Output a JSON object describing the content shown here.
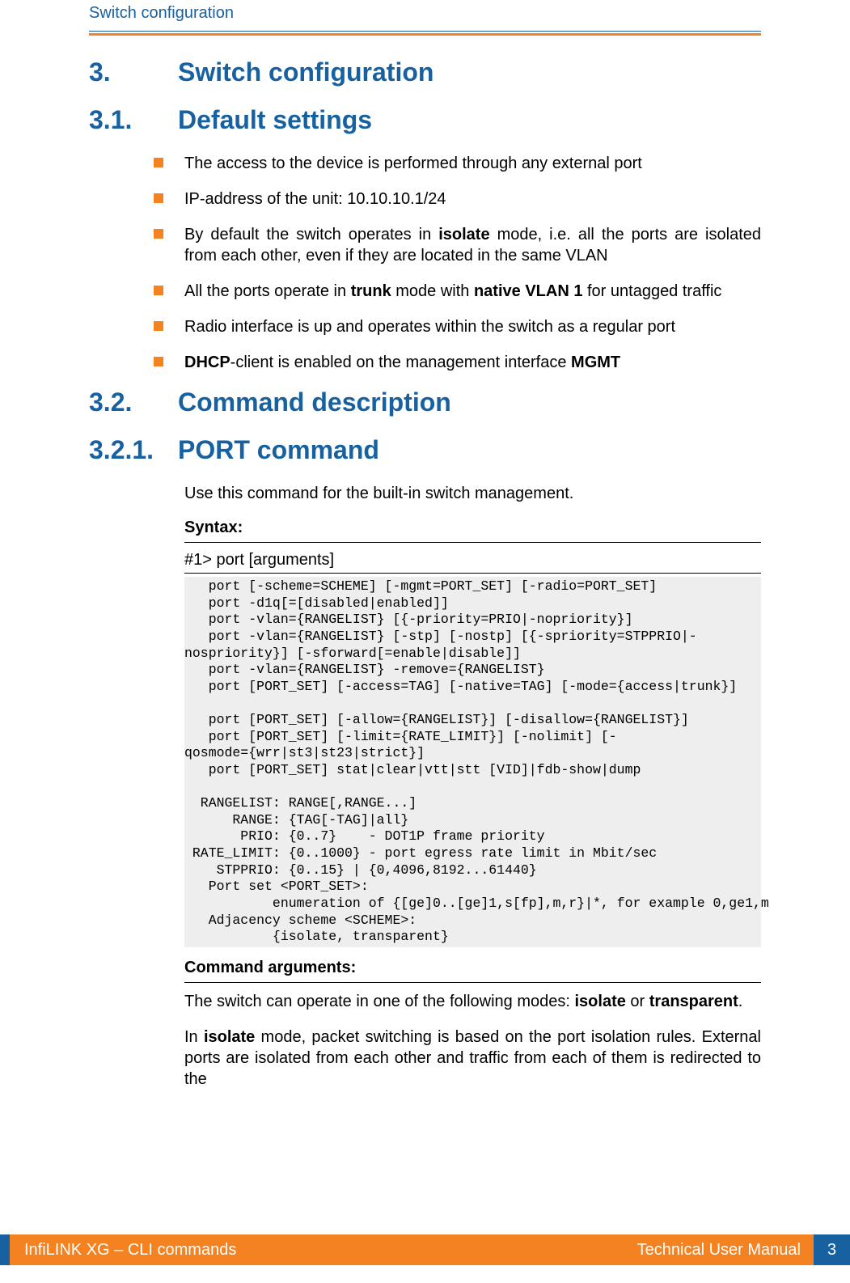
{
  "header": {
    "title": "Switch configuration"
  },
  "section3": {
    "num": "3.",
    "title": "Switch configuration"
  },
  "section31": {
    "num": "3.1.",
    "title": "Default settings",
    "bullets": {
      "b1": "The access to the device is performed through any external port",
      "b2": "IP-address of the unit: 10.10.10.1/24",
      "b3_pre": "By default the switch operates in ",
      "b3_bold": "isolate",
      "b3_post": " mode, i.e. all the ports are isolated from each other, even if they are located in the same VLAN",
      "b4_pre": "All the ports operate in ",
      "b4_b1": "trunk",
      "b4_mid": " mode with ",
      "b4_b2": "native VLAN 1",
      "b4_post": " for untagged traffic",
      "b5": "Radio interface is up and operates within the switch as a regular port",
      "b6_b1": "DHCP",
      "b6_mid": "-client is enabled on the management interface ",
      "b6_b2": "MGMT"
    }
  },
  "section32": {
    "num": "3.2.",
    "title": "Command description"
  },
  "section321": {
    "num": "3.2.1.",
    "title": "PORT command",
    "intro": "Use this command for the built-in switch management.",
    "syntax_label": "Syntax:",
    "prompt": "#1> port [arguments]",
    "code": "   port [-scheme=SCHEME] [-mgmt=PORT_SET] [-radio=PORT_SET]\n   port -d1q[=[disabled|enabled]]\n   port -vlan={RANGELIST} [{-priority=PRIO|-nopriority}]\n   port -vlan={RANGELIST} [-stp] [-nostp] [{-spriority=STPPRIO|-\nnospriority}] [-sforward[=enable|disable]]\n   port -vlan={RANGELIST} -remove={RANGELIST}\n   port [PORT_SET] [-access=TAG] [-native=TAG] [-mode={access|trunk}]\n\n   port [PORT_SET] [-allow={RANGELIST}] [-disallow={RANGELIST}]\n   port [PORT_SET] [-limit={RATE_LIMIT}] [-nolimit] [-\nqosmode={wrr|st3|st23|strict}]\n   port [PORT_SET] stat|clear|vtt|stt [VID]|fdb-show|dump\n\n  RANGELIST: RANGE[,RANGE...]\n      RANGE: {TAG[-TAG]|all}\n       PRIO: {0..7}    - DOT1P frame priority\n RATE_LIMIT: {0..1000} - port egress rate limit in Mbit/sec\n    STPPRIO: {0..15} | {0,4096,8192...61440}\n   Port set <PORT_SET>:\n           enumeration of {[ge]0..[ge]1,s[fp],m,r}|*, for example 0,ge1,m\n   Adjacency scheme <SCHEME>:\n           {isolate, transparent}",
    "cmd_args_label": "Command arguments:",
    "para1_pre": "The switch can operate in one of the following modes: ",
    "para1_b1": "isolate",
    "para1_mid": " or ",
    "para1_b2": "transparent",
    "para1_post": ".",
    "para2_pre": "In ",
    "para2_b1": "isolate",
    "para2_post": " mode, packet switching is based on the port isolation rules. External ports are isolated from each other and traffic from each of them is redirected to the"
  },
  "footer": {
    "left": "InfiLINK XG – CLI commands",
    "right": "Technical User Manual",
    "page": "3"
  }
}
